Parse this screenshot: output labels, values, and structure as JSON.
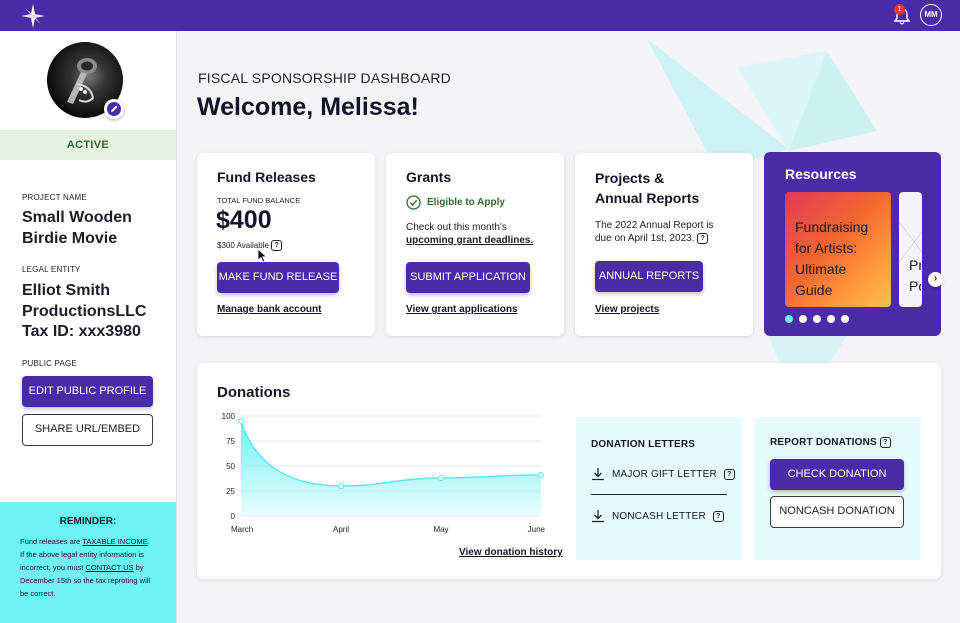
{
  "header": {
    "notification_count": "1",
    "user_initials": "MM",
    "colors": {
      "brand": "#4a2ba8",
      "accent": "#6ef2f4"
    }
  },
  "sidebar": {
    "status": "ACTIVE",
    "project_name_label": "PROJECT NAME",
    "project_name_line1": "Small Wooden",
    "project_name_line2": "Birdie Movie",
    "legal_entity_label": "LEGAL ENTITY",
    "legal_entity_line1": "Elliot Smith",
    "legal_entity_line2": "ProductionsLLC",
    "tax_id": "Tax ID: xxx3980",
    "public_page_label": "PUBLIC PAGE",
    "edit_profile_button": "EDIT PUBLIC PROFILE",
    "share_button": "SHARE URL/EMBED",
    "reminder_title": "REMINDER:",
    "reminder_p1": "Fund releases are ",
    "reminder_link1": "TAXABLE INCOME",
    "reminder_p2": ". If the above legal entity information is incorrect, you must ",
    "reminder_link2": "CONTACT US",
    "reminder_p3": " by December 15th so the tax reproting will be correct."
  },
  "main": {
    "dashboard_label": "FISCAL SPONSORSHIP DASHBOARD",
    "welcome": "Welcome, Melissa!"
  },
  "fund_releases": {
    "title": "Fund Releases",
    "balance_label": "TOTAL FUND BALANCE",
    "balance": "$400",
    "available": "$300 Available",
    "button": "MAKE FUND RELEASE",
    "link": "Manage bank account"
  },
  "grants": {
    "title": "Grants",
    "status": "Eligible to Apply",
    "text": "Check out this month's",
    "text_link": "upcoming grant deadlines.",
    "button": "SUBMIT APPLICATION",
    "link": "View grant applications"
  },
  "projects": {
    "title_line1": "Projects &",
    "title_line2": "Annual Reports",
    "text_line1": "The 2022 Annual Report is",
    "text_line2": "due on April 1st, 2023.",
    "button": "ANNUAL REPORTS",
    "link": "View projects"
  },
  "resources": {
    "title": "Resources",
    "tile1_text": "Fundraising for Artists: Ultimate Guide",
    "tile2_text": "Pr Po",
    "active_slide": 1,
    "slide_count": 5
  },
  "donations": {
    "title": "Donations",
    "history_link": "View donation history",
    "letters_title": "DONATION LETTERS",
    "major_gift": "MAJOR GIFT LETTER",
    "noncash_letter": "NONCASH LETTER",
    "report_title": "REPORT DONATIONS",
    "check_button": "CHECK DONATION",
    "noncash_button": "NONCASH DONATION"
  },
  "chart_data": {
    "type": "area",
    "categories": [
      "March",
      "April",
      "May",
      "June"
    ],
    "x": [
      0,
      1,
      2,
      3
    ],
    "values": [
      95,
      30,
      38,
      41
    ],
    "ylim": [
      0,
      100
    ],
    "yticks": [
      0,
      25,
      50,
      75,
      100
    ],
    "grid": true,
    "colors": {
      "fill": "#6ef2f4",
      "line": "#5ee6ec"
    }
  }
}
